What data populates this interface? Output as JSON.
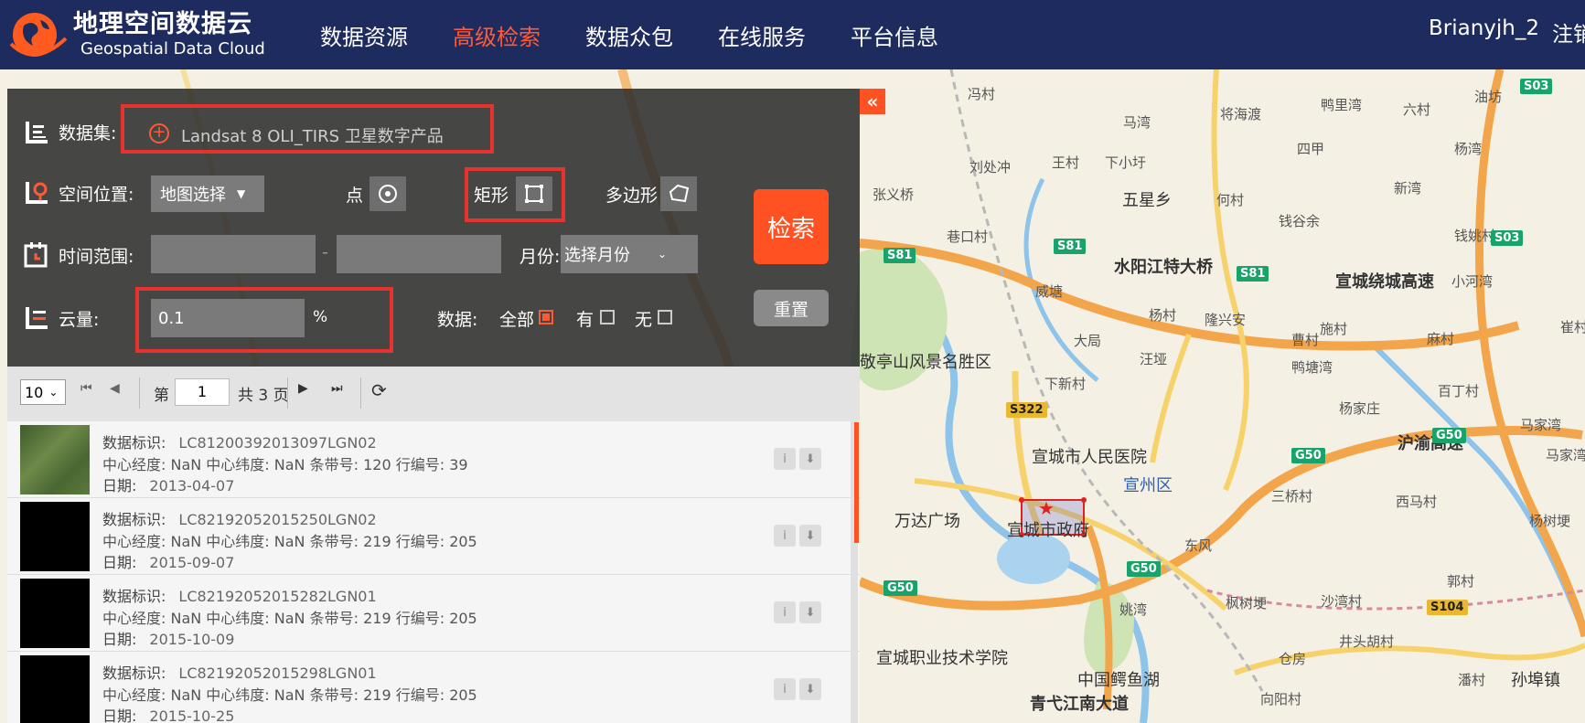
{
  "header": {
    "logo_cn": "地理空间数据云",
    "logo_en": "Geospatial Data Cloud",
    "nav": [
      "数据资源",
      "高级检索",
      "数据众包",
      "在线服务",
      "平台信息"
    ],
    "active_nav": "高级检索",
    "user": "Brianyjh_2",
    "logout": "注销"
  },
  "search": {
    "dataset_label": "数据集:",
    "dataset_value": "Landsat 8 OLI_TIRS 卫星数字产品",
    "location_label": "空间位置:",
    "location_select": "地图选择",
    "point_label": "点",
    "rect_label": "矩形",
    "polygon_label": "多边形",
    "time_label": "时间范围:",
    "time_sep": "-",
    "month_label": "月份:",
    "month_select": "选择月份",
    "cloud_label": "云量:",
    "cloud_value": "0.1",
    "cloud_unit": "%",
    "data_label": "数据:",
    "opt_all": "全部",
    "opt_has": "有",
    "opt_none": "无",
    "search_btn": "检索",
    "reset_btn": "重置",
    "collapse": "«"
  },
  "pager": {
    "page_size": "10",
    "page_prefix": "第",
    "page_value": "1",
    "page_total": "共 3 页"
  },
  "results": [
    {
      "id_label": "数据标识:",
      "id": "LC81200392013097LGN02",
      "coords": "中心经度:   NaN 中心纬度:   NaN 条带号: 120 行编号: 39",
      "date_label": "日期:",
      "date": "2013-04-07"
    },
    {
      "id_label": "数据标识:",
      "id": "LC82192052015250LGN02",
      "coords": "中心经度:   NaN 中心纬度:   NaN 条带号: 219 行编号: 205",
      "date_label": "日期:",
      "date": "2015-09-07"
    },
    {
      "id_label": "数据标识:",
      "id": "LC82192052015282LGN01",
      "coords": "中心经度:   NaN 中心纬度:   NaN 条带号: 219 行编号: 205",
      "date_label": "日期:",
      "date": "2015-10-09"
    },
    {
      "id_label": "数据标识:",
      "id": "LC82192052015298LGN01",
      "coords": "中心经度:   NaN 中心纬度:   NaN 条带号: 219 行编号: 205",
      "date_label": "日期:",
      "date": "2015-10-25"
    }
  ],
  "map": {
    "labels": [
      "冯村",
      "马湾",
      "下小圩",
      "五星乡",
      "王村",
      "刘处冲",
      "何村",
      "四甲",
      "新湾",
      "杨湾",
      "鸭里湾",
      "六村",
      "油坊",
      "张义桥",
      "水阳江特大桥",
      "宣城绕城高速",
      "巷口村",
      "威塘",
      "杨村",
      "隆兴安",
      "施村",
      "麻村",
      "大局",
      "汪垭",
      "下新村",
      "敬亭山风景名胜区",
      "宣城市人民医院",
      "宣州区",
      "万达广场",
      "宣城市政府",
      "沪渝高速",
      "杨家庄",
      "百丁村",
      "马家湾",
      "三桥村",
      "西马村",
      "东风",
      "姚湾",
      "枫树埂",
      "沙湾村",
      "郭村",
      "井头胡村",
      "宣城职业技术学院",
      "中国鳄鱼湖",
      "青弋江南大道",
      "孙埠镇",
      "仓房",
      "向阳村",
      "潘村",
      "杨树埂",
      "钱姚村",
      "将海渡",
      "钱谷余",
      "小河湾",
      "崔村",
      "曹村",
      "鸭塘湾",
      "马家湾"
    ],
    "shields": [
      "S81",
      "S81",
      "S81",
      "S322",
      "G50",
      "G50",
      "G50",
      "G50",
      "S104",
      "S03",
      "S03"
    ]
  },
  "colors": {
    "header_bg": "#1e2b5e",
    "accent": "#ff5121",
    "highlight_box": "#e8322e"
  }
}
